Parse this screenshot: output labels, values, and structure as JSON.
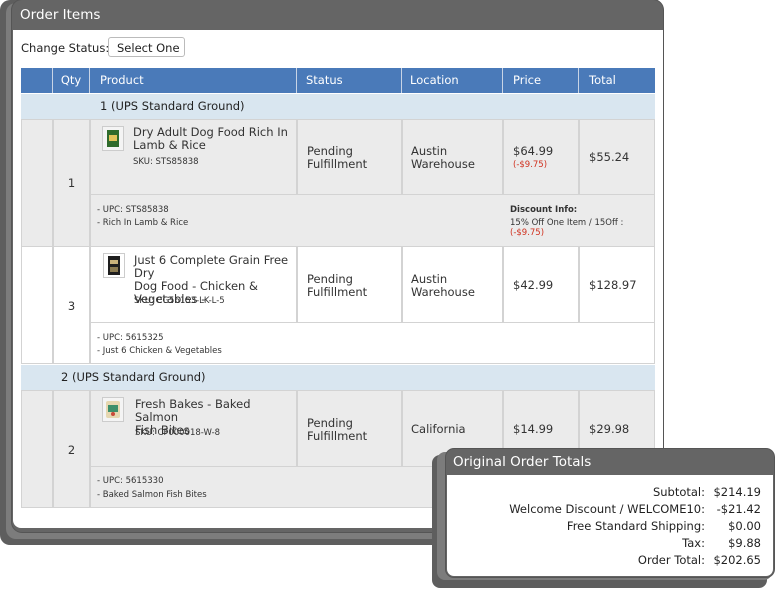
{
  "panel": {
    "title": "Order Items"
  },
  "change_status": {
    "label": "Change Status:",
    "selected": "Select One"
  },
  "table": {
    "headers": [
      "Qty",
      "Product",
      "Status",
      "Location",
      "Price",
      "Total"
    ],
    "groups": [
      {
        "label": "1 (UPS Standard Ground)",
        "items": [
          {
            "qty": "1",
            "name_line1": "Dry Adult Dog Food Rich In",
            "name_line2": "Lamb & Rice",
            "sku": "SKU: STS85838",
            "status_line1": "Pending",
            "status_line2": "Fulfillment",
            "location_line1": "Austin",
            "location_line2": "Warehouse",
            "price": "$64.99",
            "price_discount": "(-$9.75)",
            "total": "$55.24",
            "upc": "- UPC: STS85838",
            "detail": "- Rich In Lamb & Rice",
            "discount_title": "Discount Info:",
            "discount_text": "15% Off One Item  /  15Off :",
            "discount_amount": "(-$9.75)"
          },
          {
            "qty": "3",
            "name_line1": "Just 6 Complete Grain Free Dry",
            "name_line2": "Dog Food - Chicken &",
            "name_line3": "Vegetables -",
            "sku": "SKU: CG56153-LK-L-5",
            "status_line1": "Pending",
            "status_line2": "Fulfillment",
            "location_line1": "Austin",
            "location_line2": "Warehouse",
            "price": "$42.99",
            "total": "$128.97",
            "upc": "- UPC: 5615325",
            "detail": "- Just 6 Chicken & Vegetables"
          }
        ]
      },
      {
        "label": "2 (UPS Standard Ground)",
        "items": [
          {
            "qty": "2",
            "name_line1": "Fresh Bakes - Baked Salmon",
            "name_line2": "Fish Bites",
            "sku": "SKU: CF000018-W-8",
            "status_line1": "Pending",
            "status_line2": "Fulfillment",
            "location_line1": "California",
            "price": "$14.99",
            "total": "$29.98",
            "upc": "- UPC: 5615330",
            "detail": "- Baked Salmon Fish Bites"
          }
        ]
      }
    ]
  },
  "totals": {
    "title": "Original Order Totals",
    "rows": [
      {
        "label": "Subtotal:",
        "value": "$214.19"
      },
      {
        "label": "Welcome Discount / WELCOME10:",
        "value": "-$21.42"
      },
      {
        "label": "Free Standard Shipping:",
        "value": "$0.00"
      },
      {
        "label": "Tax:",
        "value": "$9.88"
      },
      {
        "label": "Order Total:",
        "value": "$202.65"
      }
    ]
  },
  "colors": {
    "header": "#4a7ab9",
    "group_row": "#d9e6f0",
    "discount_red": "#d0301e",
    "panel_frame": "#656565"
  },
  "icons": [
    "product-image-lamb-rice",
    "product-image-just6",
    "product-image-salmon-bites"
  ]
}
